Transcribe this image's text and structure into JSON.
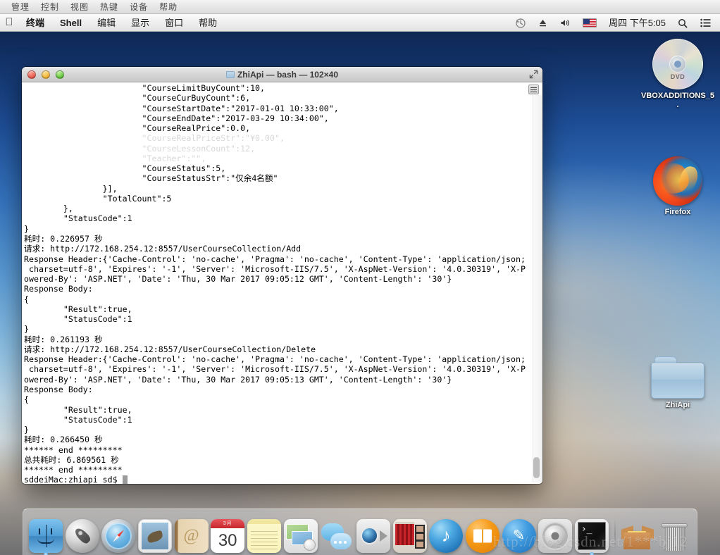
{
  "vbox_menu": {
    "items": [
      "管理",
      "控制",
      "视图",
      "热键",
      "设备",
      "帮助"
    ]
  },
  "mac_menubar": {
    "apple": "",
    "items": [
      "终端",
      "Shell",
      "编辑",
      "显示",
      "窗口",
      "帮助"
    ],
    "right": {
      "timemachine_icon": "time-machine-icon",
      "eject_icon": "eject-icon",
      "volume_icon": "volume-icon",
      "flag_icon": "us-flag-icon",
      "clock": "周四 下午5:05",
      "search_icon": "search-icon",
      "notification_icon": "notification-center-icon"
    }
  },
  "desktop_icons": [
    {
      "name": "VBOXADDITIONS_5.",
      "type": "dvd",
      "badge": "DVD"
    },
    {
      "name": "Firefox",
      "type": "app"
    },
    {
      "name": "ZhiApi",
      "type": "folder"
    }
  ],
  "terminal": {
    "title": "ZhiApi — bash — 102×40",
    "traffic_lights": {
      "close": "close-button",
      "minimize": "minimize-button",
      "zoom": "zoom-button"
    },
    "fullscreen_icon": "fullscreen-icon",
    "prompt": "sddeiMac:zhiapi sd$ ",
    "lines": [
      "                        \"CourseLimitBuyCount\":10,",
      "                        \"CourseCurBuyCount\":6,",
      "                        \"CourseStartDate\":\"2017-01-01 10:33:00\",",
      "                        \"CourseEndDate\":\"2017-03-29 10:34:00\",",
      "                        \"CourseRealPrice\":0.0,",
      "                        \"CourseRealPriceStr\":\"¥0.00\",",
      "                        \"CourseLessonCount\":12,",
      "                        \"Teacher\":\"\",",
      "                        \"CourseStatus\":5,",
      "                        \"CourseStatusStr\":\"仅余4名额\"",
      "                }],",
      "                \"TotalCount\":5",
      "        },",
      "        \"StatusCode\":1",
      "}",
      "耗时: 0.226957 秒",
      "请求: http://172.168.254.12:8557/UserCourseCollection/Add",
      "Response Header:{'Cache-Control': 'no-cache', 'Pragma': 'no-cache', 'Content-Type': 'application/json;",
      " charset=utf-8', 'Expires': '-1', 'Server': 'Microsoft-IIS/7.5', 'X-AspNet-Version': '4.0.30319', 'X-P",
      "owered-By': 'ASP.NET', 'Date': 'Thu, 30 Mar 2017 09:05:12 GMT', 'Content-Length': '30'}",
      "Response Body:",
      "{",
      "        \"Result\":true,",
      "        \"StatusCode\":1",
      "}",
      "耗时: 0.261193 秒",
      "请求: http://172.168.254.12:8557/UserCourseCollection/Delete",
      "Response Header:{'Cache-Control': 'no-cache', 'Pragma': 'no-cache', 'Content-Type': 'application/json;",
      " charset=utf-8', 'Expires': '-1', 'Server': 'Microsoft-IIS/7.5', 'X-AspNet-Version': '4.0.30319', 'X-P",
      "owered-By': 'ASP.NET', 'Date': 'Thu, 30 Mar 2017 09:05:13 GMT', 'Content-Length': '30'}",
      "Response Body:",
      "{",
      "        \"Result\":true,",
      "        \"StatusCode\":1",
      "}",
      "耗时: 0.266450 秒",
      "****** end *********",
      "总共耗时: 6.869561 秒",
      "****** end *********"
    ],
    "faded_line_indices": [
      5,
      6,
      7
    ]
  },
  "dock": {
    "items": [
      {
        "name": "Finder",
        "icon": "finder-icon",
        "running": true
      },
      {
        "name": "Launchpad",
        "icon": "launchpad-icon",
        "running": false
      },
      {
        "name": "Safari",
        "icon": "safari-icon",
        "running": false
      },
      {
        "name": "Mail",
        "icon": "mail-icon",
        "running": false
      },
      {
        "name": "Contacts",
        "icon": "contacts-icon",
        "running": false
      },
      {
        "name": "Calendar",
        "icon": "calendar-icon",
        "running": false,
        "month": "3月",
        "day": "30"
      },
      {
        "name": "Notes",
        "icon": "notes-icon",
        "running": false
      },
      {
        "name": "Maps",
        "icon": "maps-icon",
        "running": false
      },
      {
        "name": "Messages",
        "icon": "messages-icon",
        "running": false
      },
      {
        "name": "FaceTime",
        "icon": "facetime-icon",
        "running": false
      },
      {
        "name": "Photo Booth",
        "icon": "photo-booth-icon",
        "running": false
      },
      {
        "name": "iTunes",
        "icon": "itunes-icon",
        "running": false
      },
      {
        "name": "iBooks",
        "icon": "ibooks-icon",
        "running": false
      },
      {
        "name": "App Store",
        "icon": "app-store-icon",
        "running": false
      },
      {
        "name": "System Preferences",
        "icon": "system-preferences-icon",
        "running": false
      },
      {
        "name": "Terminal",
        "icon": "terminal-icon",
        "running": true
      },
      {
        "name": "Downloads",
        "icon": "downloads-stack-icon",
        "running": false
      },
      {
        "name": "Trash",
        "icon": "trash-icon",
        "running": false
      }
    ]
  },
  "watermark": "http://blog.csdn.net/1***bj12",
  "colors": {
    "accent": "#3a87c4",
    "terminal_bg": "#ffffff",
    "terminal_fg": "#000000"
  }
}
